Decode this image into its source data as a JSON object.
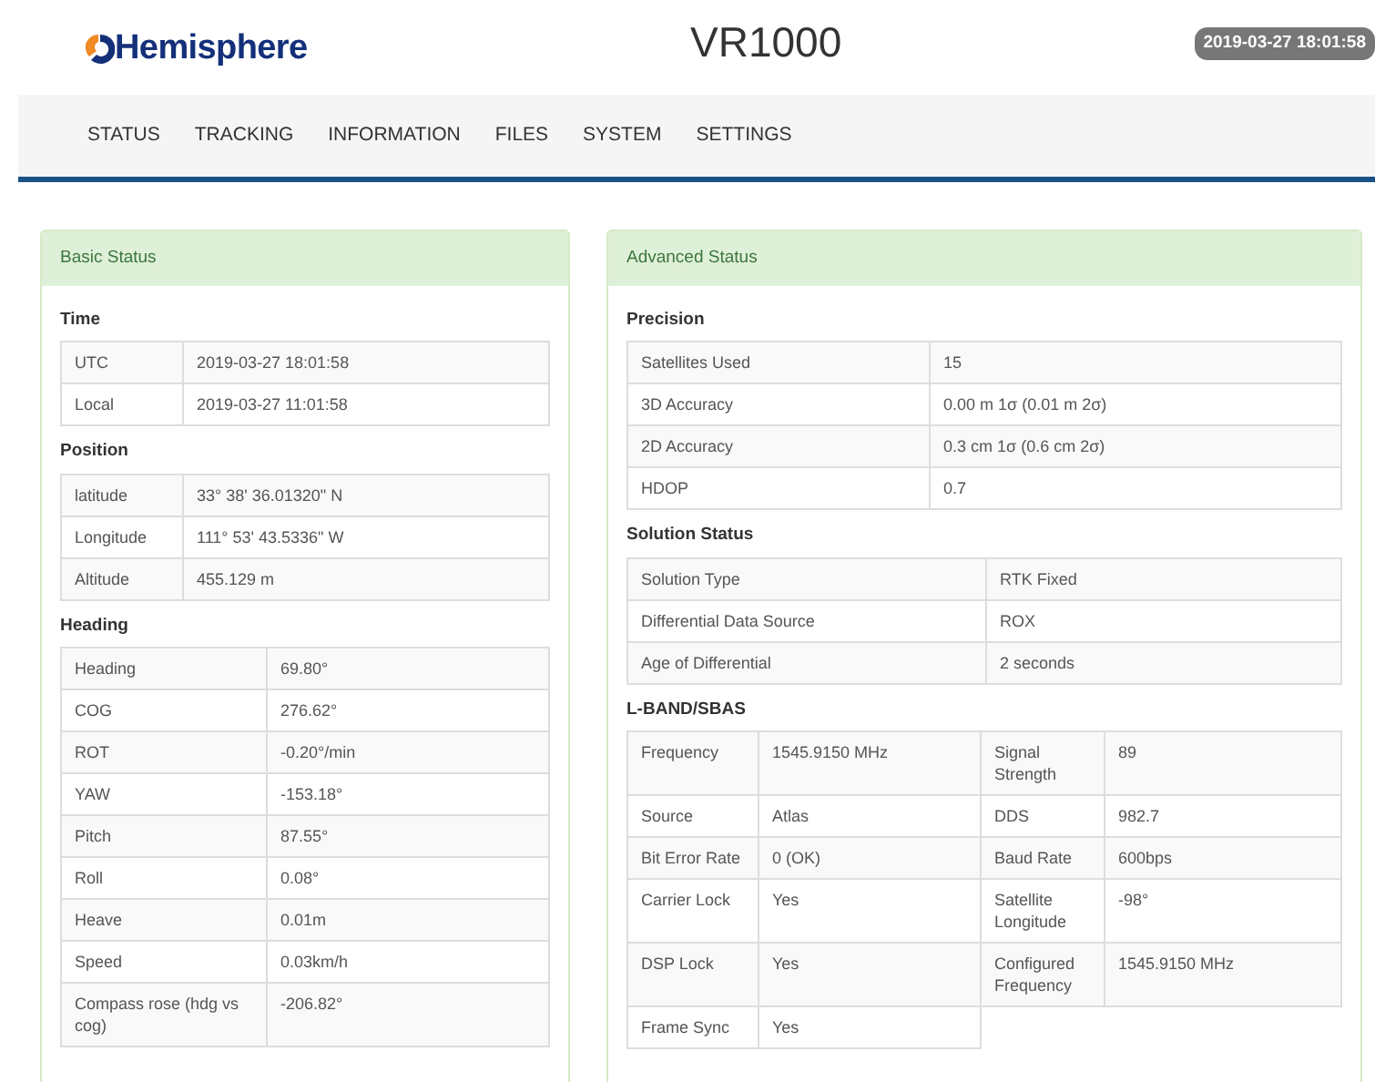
{
  "header": {
    "logo": "Hemisphere",
    "title": "VR1000",
    "timestamp": "2019-03-27 18:01:58"
  },
  "nav": [
    {
      "label": "STATUS"
    },
    {
      "label": "TRACKING"
    },
    {
      "label": "INFORMATION"
    },
    {
      "label": "FILES"
    },
    {
      "label": "SYSTEM"
    },
    {
      "label": "SETTINGS"
    }
  ],
  "panels": [
    {
      "title": "Basic Status",
      "sections": [
        {
          "title": "Time",
          "rows": [
            [
              "UTC",
              "2019-03-27 18:01:58"
            ],
            [
              "Local",
              "2019-03-27 11:01:58"
            ]
          ]
        },
        {
          "title": "Position",
          "rows": [
            [
              "latitude",
              "33° 38' 36.01320\" N"
            ],
            [
              "Longitude",
              "111° 53' 43.5336\" W"
            ],
            [
              "Altitude",
              "455.129 m"
            ]
          ]
        },
        {
          "title": "Heading",
          "rows": [
            [
              "Heading",
              "69.80°"
            ],
            [
              "COG",
              "276.62°"
            ],
            [
              "ROT",
              "-0.20°/min"
            ],
            [
              "YAW",
              "-153.18°"
            ],
            [
              "Pitch",
              "87.55°"
            ],
            [
              "Roll",
              "0.08°"
            ],
            [
              "Heave",
              "0.01m"
            ],
            [
              "Speed",
              "0.03km/h"
            ],
            [
              "Compass rose (hdg vs cog)",
              "-206.82°"
            ]
          ]
        }
      ]
    },
    {
      "title": "Advanced Status",
      "sections": [
        {
          "title": "Precision",
          "rows": [
            [
              "Satellites Used",
              "15"
            ],
            [
              "3D Accuracy",
              "0.00 m 1σ (0.01 m 2σ)"
            ],
            [
              "2D Accuracy",
              "0.3 cm 1σ (0.6 cm 2σ)"
            ],
            [
              "HDOP",
              "0.7"
            ]
          ]
        },
        {
          "title": "Solution Status",
          "rows": [
            [
              "Solution Type",
              "RTK Fixed"
            ],
            [
              "Differential Data Source",
              "ROX"
            ],
            [
              "Age of Differential",
              "2 seconds"
            ]
          ]
        },
        {
          "title": "L-BAND/SBAS",
          "rows": [
            [
              "Frequency",
              "1545.9150 MHz",
              "Signal Strength",
              "89"
            ],
            [
              "Source",
              "Atlas",
              "DDS",
              "982.7"
            ],
            [
              "Bit Error Rate",
              "0 (OK)",
              "Baud Rate",
              "600bps"
            ],
            [
              "Carrier Lock",
              "Yes",
              "Satellite Longitude",
              "-98°"
            ],
            [
              "DSP Lock",
              "Yes",
              "Configured Frequency",
              "1545.9150 MHz"
            ],
            [
              "Frame Sync",
              "Yes"
            ]
          ]
        }
      ]
    }
  ]
}
